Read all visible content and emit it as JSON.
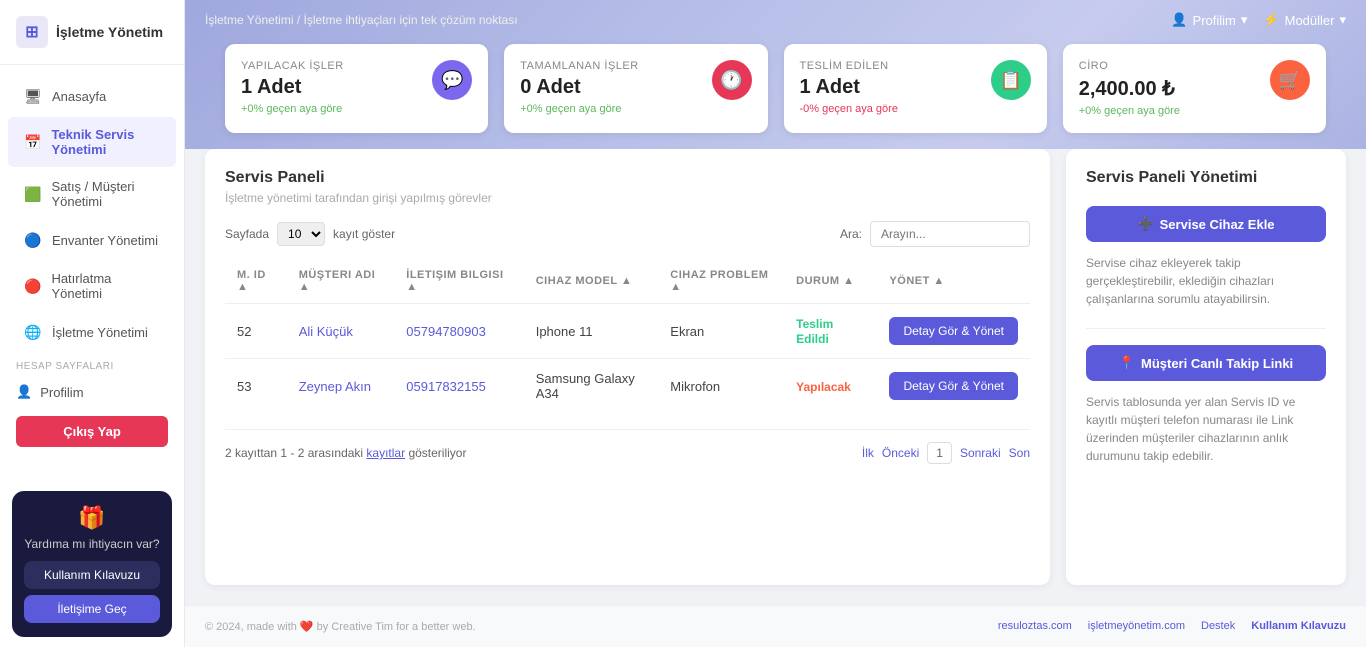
{
  "sidebar": {
    "logo_text": "İşletme Yönetim",
    "menu_items": [
      {
        "label": "Anasayfa",
        "icon": "🏠",
        "active": false
      },
      {
        "label": "Teknik Servis Yönetimi",
        "icon": "📅",
        "active": true
      },
      {
        "label": "Satış / Müşteri Yönetimi",
        "icon": "🟩",
        "active": false
      },
      {
        "label": "Envanter Yönetimi",
        "icon": "🔵",
        "active": false
      },
      {
        "label": "Hatırlatma Yönetimi",
        "icon": "🔴",
        "active": false
      },
      {
        "label": "İşletme Yönetimi",
        "icon": "🌐",
        "active": false
      }
    ],
    "section_label": "HESAP SAYFALARI",
    "profile_label": "Profilim",
    "logout_label": "Çıkış Yap",
    "help_icon": "🎁",
    "help_title": "Yardıma mı ihtiyacın var?",
    "help_btn1": "Kullanım Kılavuzu",
    "help_btn2": "İletişime Geç"
  },
  "topbar": {
    "breadcrumb": "İşletme Yönetimi / İşletme ihtiyaçları için tek çözüm noktası",
    "profile_label": "Profilim",
    "modules_label": "Modüller"
  },
  "stats": [
    {
      "label": "YAPILACAK İŞLER",
      "value": "1 Adet",
      "change": "+0% geçen aya göre",
      "change_positive": true,
      "icon": "💬",
      "icon_class": "purple"
    },
    {
      "label": "TAMAMLANAN İŞLER",
      "value": "0 Adet",
      "change": "+0% geçen aya göre",
      "change_positive": true,
      "icon": "🕐",
      "icon_class": "red"
    },
    {
      "label": "TESLİM EDİLEN",
      "value": "1 Adet",
      "change": "-0% geçen aya göre",
      "change_positive": false,
      "icon": "📋",
      "icon_class": "green"
    },
    {
      "label": "CİRO",
      "value": "2,400.00 ₺",
      "change": "+0% geçen aya göre",
      "change_positive": true,
      "icon": "🛒",
      "icon_class": "orange"
    }
  ],
  "panel": {
    "title": "Servis Paneli",
    "subtitle": "İşletme yönetimi tarafından girişi yapılmış görevler",
    "show_label": "Sayfada",
    "records_label": "kayıt göster",
    "search_label": "Ara:",
    "search_placeholder": "Arayın...",
    "columns": [
      "M. ID",
      "Müşteri Adı",
      "İletişim Bilgisi",
      "Cihaz Model",
      "Cihaz Problem",
      "Durum",
      "Yönet"
    ],
    "rows": [
      {
        "id": "52",
        "name": "Ali Küçük",
        "phone": "05794780903",
        "device": "Iphone 11",
        "problem": "Ekran",
        "status": "Teslim Edildi",
        "status_class": "badge-teslim",
        "btn_label": "Detay Gör & Yönet"
      },
      {
        "id": "53",
        "name": "Zeynep Akın",
        "phone": "05917832155",
        "device": "Samsung Galaxy A34",
        "problem": "Mikrofon",
        "status": "Yapılacak",
        "status_class": "badge-yapilacak",
        "btn_label": "Detay Gör & Yönet"
      }
    ],
    "pagination_info": "2 kayıttan 1 - 2 arasındaki kayıtlar gösteriliyor",
    "pagination_link_text": "kayıtlar",
    "ilk": "İlk",
    "onceki": "Önceki",
    "page": "1",
    "sonraki": "Sonraki",
    "son": "Son"
  },
  "side_panel": {
    "title": "Servis Paneli Yönetimi",
    "add_btn": "Servise Cihaz Ekle",
    "add_icon": "➕",
    "add_desc": "Servise cihaz ekleyerek takip gerçekleştirebilir, eklediğin cihazları çalışanlarına sorumlu atayabilirsin.",
    "link_btn": "Müşteri Canlı Takip Linki",
    "link_icon": "📍",
    "link_desc": "Servis tablosunda yer alan Servis ID ve kayıtlı müşteri telefon numarası ile Link üzerinden müşteriler cihazlarının anlık durumunu takip edebilir."
  },
  "footer": {
    "copyright": "© 2024, made with ❤️ by Creative Tim for a better web.",
    "links": [
      {
        "label": "resuloztas.com",
        "url": "#"
      },
      {
        "label": "işletmeyönetim.com",
        "url": "#"
      },
      {
        "label": "Destek",
        "url": "#"
      },
      {
        "label": "Kullanım Kılavuzu",
        "url": "#"
      }
    ]
  }
}
